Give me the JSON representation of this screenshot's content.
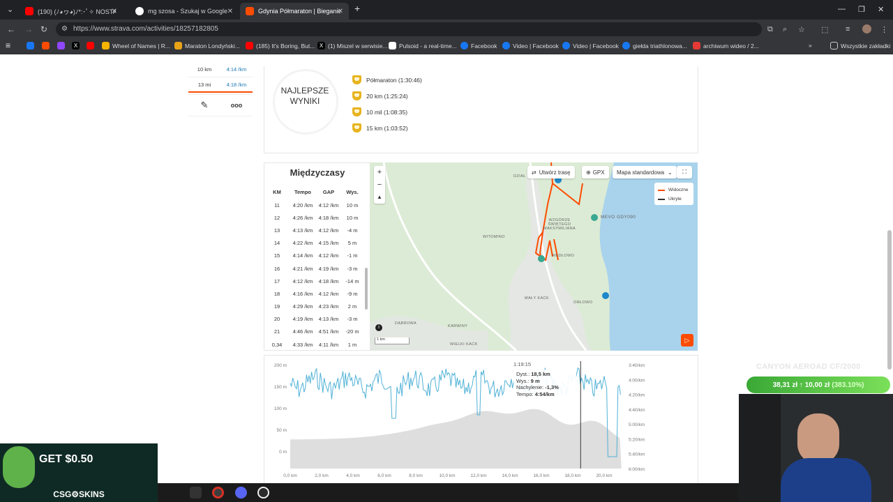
{
  "browser": {
    "tabs": [
      {
        "title": "(190) (ﾉ◕ヮ◕)ﾉ*:･ﾟ✧ NOSTA",
        "active": false
      },
      {
        "title": "mg szosa - Szukaj w Google",
        "active": false
      },
      {
        "title": "Gdynia Półmaraton | Bieganie |",
        "active": true
      }
    ],
    "url": "https://www.strava.com/activities/18257182805",
    "bookmarks": [
      "Wheel of Names | R...",
      "Maraton Londyński...",
      "(185) It's Boring, But...",
      "(1) Miszel w serwisie...",
      "Pulsoid - a real-time...",
      "Facebook",
      "Video | Facebook",
      "Video | Facebook",
      "giełda triathlonowa...",
      "archiwum wideo / 2..."
    ],
    "all_bookmarks": "Wszystkie zakładki"
  },
  "laps": [
    {
      "distance": "10 km",
      "pace": "4:14 /km"
    },
    {
      "distance": "13 mi",
      "pace": "4:18 /km"
    }
  ],
  "best": {
    "title_line1": "NAJLEPSZE",
    "title_line2": "WYNIKI",
    "items": [
      "Półmaraton (1:30:46)",
      "20 km (1:25:24)",
      "10 mil (1:08:35)",
      "15 km (1:03:52)"
    ]
  },
  "splits": {
    "title": "Międzyczasy",
    "headers": [
      "KM",
      "Tempo",
      "GAP",
      "Wys."
    ],
    "rows": [
      [
        "11",
        "4:20 /km",
        "4:12 /km",
        "10 m"
      ],
      [
        "12",
        "4:26 /km",
        "4:18 /km",
        "10 m"
      ],
      [
        "13",
        "4:13 /km",
        "4:12 /km",
        "-4 m"
      ],
      [
        "14",
        "4:22 /km",
        "4:15 /km",
        "5 m"
      ],
      [
        "15",
        "4:14 /km",
        "4:12 /km",
        "-1 m"
      ],
      [
        "16",
        "4:21 /km",
        "4:19 /km",
        "-3 m"
      ],
      [
        "17",
        "4:12 /km",
        "4:18 /km",
        "-14 m"
      ],
      [
        "18",
        "4:16 /km",
        "4:12 /km",
        "-9 m"
      ],
      [
        "19",
        "4:29 /km",
        "4:23 /km",
        "2 m"
      ],
      [
        "20",
        "4:19 /km",
        "4:13 /km",
        "-3 m"
      ],
      [
        "21",
        "4:46 /km",
        "4:51 /km",
        "-20 m"
      ],
      [
        "0,34",
        "4:33 /km",
        "4:11 /km",
        "1 m"
      ]
    ]
  },
  "map": {
    "create_route": "Utwórz trasę",
    "gpx": "GPX",
    "map_type": "Mapa standardowa",
    "legend_visible": "Widoczne",
    "legend_hidden": "Ukryte",
    "scale": "1 km",
    "labels": [
      "WITOMINO",
      "MEVO GDY090",
      "WZGÓRZE ŚWIĘTEGO MAKSYMILIANA",
      "REDŁOWO",
      "MAŁY KACK",
      "ORŁOWO",
      "DĄBROWA",
      "KARWINY",
      "WIELKI KACK",
      "DZIAŁ"
    ],
    "colors": {
      "route": "#fc4c02",
      "hidden": "#333333",
      "sea": "#a9d3ec",
      "land": "#dcebd5"
    }
  },
  "elevation": {
    "y_left": [
      "200 m",
      "150 m",
      "100 m",
      "50 m",
      "0 m"
    ],
    "y_right": [
      "3:40/km",
      "4:00/km",
      "4:20/km",
      "4:40/km",
      "5:00/km",
      "5:20/km",
      "5:40/km",
      "6:00/km"
    ],
    "x": [
      "0,0 km",
      "2,0 km",
      "4,0 km",
      "6,0 km",
      "8,0 km",
      "10,0 km",
      "12,0 km",
      "14,0 km",
      "16,0 km",
      "18,0 km",
      "20,0 km"
    ],
    "tooltip": {
      "time": "1:19:15",
      "dist_label": "Dyst.:",
      "dist": "18,5 km",
      "elev_label": "Wys.:",
      "elev": "9 m",
      "grade_label": "Nachylenie:",
      "grade": "-1,3%",
      "pace_label": "Tempo:",
      "pace": "4:54/km"
    },
    "cursor_km": 18.5,
    "colors": {
      "pace": "#4fb1d6",
      "elevation_fill": "#dedede"
    }
  },
  "overlays": {
    "promo": "GET $0.50",
    "promo_brand": "CSG⚙SKINS",
    "product": "CANYON AEROAD CF/2000",
    "price": "38,31 zł ↑ 10,00 zł",
    "price_pct": "(383.10%)"
  }
}
